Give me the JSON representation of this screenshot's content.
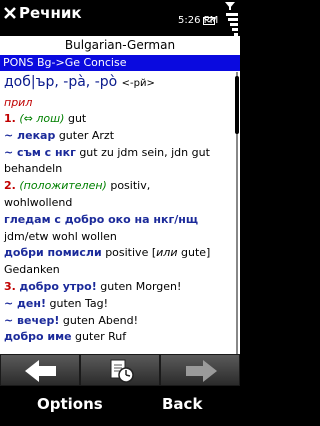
{
  "titlebar": {
    "app_title": "Речник",
    "clock": "5:26 PM"
  },
  "dictionary": {
    "name": "Bulgarian-German",
    "direction": "PONS Bg->Ge Concise"
  },
  "entry": {
    "headword": "доб|ър, -рà, -рò",
    "headword_pron": "<-рй>",
    "part_of_speech": "прил",
    "s1_num": "1.",
    "s1_note": "(⇔ лош)",
    "s1_trans": "gut",
    "ph1_bg": "~ лекар",
    "ph1_de": "guter Arzt",
    "ph2_bg": "~ съм с нкг",
    "ph2_de": "gut zu jdm sein, jdn gut",
    "ph2_de_cont": "behandeln",
    "s2_num": "2.",
    "s2_note": "(положителен)",
    "s2_trans": "positiv,",
    "s2_trans_cont": "wohlwollend",
    "ph3_bg": "гледам с добро око на нкг/нщ",
    "ph3_de": "jdm/etw wohl wollen",
    "ph4_bg": "добри помисли",
    "ph4_de_a": "positive",
    "ph4_de_b": "[",
    "ph4_de_or": "или",
    "ph4_de_c": "gute]",
    "ph4_de_cont": "Gedanken",
    "s3_num": "3.",
    "s3_bg": "добро утро!",
    "s3_de": "guten Morgen!",
    "ph5_bg": "~ ден!",
    "ph5_de": "guten Tag!",
    "ph6_bg": "~ вечер!",
    "ph6_de": "guten Abend!",
    "ph7_bg": "добро име",
    "ph7_de": "guter Ruf"
  },
  "softkeys": {
    "left": "Options",
    "right": "Back"
  },
  "icons": {
    "close": "close-icon",
    "mail": "mail-icon",
    "back": "arrow-left-icon",
    "history": "history-icon",
    "forward": "arrow-right-icon"
  },
  "colors": {
    "accent_bar": "#0a0adf",
    "sense_number": "#c00000",
    "bulgarian_text": "#1b2a9a",
    "note": "#008000"
  }
}
